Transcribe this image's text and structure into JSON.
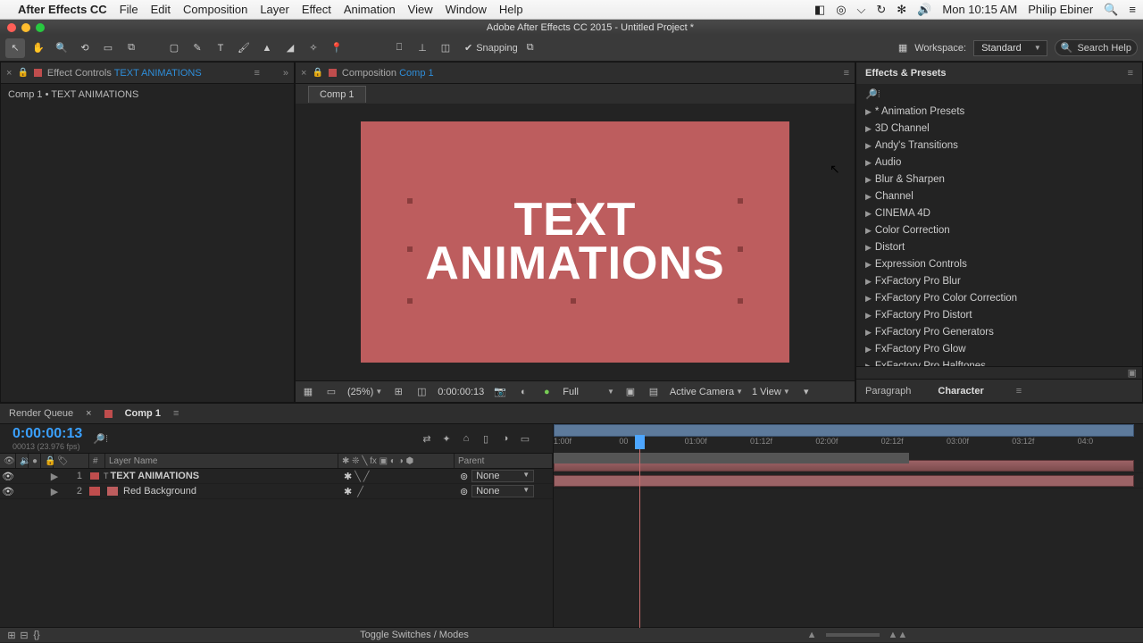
{
  "menubar": {
    "app": "After Effects CC",
    "items": [
      "File",
      "Edit",
      "Composition",
      "Layer",
      "Effect",
      "Animation",
      "View",
      "Window",
      "Help"
    ],
    "clock": "Mon 10:15 AM",
    "user": "Philip Ebiner"
  },
  "window_title": "Adobe After Effects CC 2015 - Untitled Project *",
  "toolbar": {
    "snapping": "Snapping",
    "workspace_label": "Workspace:",
    "workspace": "Standard",
    "search_placeholder": "Search Help"
  },
  "effect_controls": {
    "title": "Effect Controls",
    "layer": "TEXT ANIMATIONS",
    "breadcrumb": "Comp 1 • TEXT ANIMATIONS"
  },
  "composition": {
    "panel": "Composition",
    "name": "Comp 1",
    "tab": "Comp 1",
    "text_line1": "TEXT",
    "text_line2": "ANIMATIONS"
  },
  "viewer_footer": {
    "zoom": "(25%)",
    "timecode": "0:00:00:13",
    "resolution": "Full",
    "camera": "Active Camera",
    "views": "1 View"
  },
  "effects_presets": {
    "title": "Effects & Presets",
    "items": [
      "* Animation Presets",
      "3D Channel",
      "Andy's Transitions",
      "Audio",
      "Blur & Sharpen",
      "Channel",
      "CINEMA 4D",
      "Color Correction",
      "Distort",
      "Expression Controls",
      "FxFactory Pro Blur",
      "FxFactory Pro Color Correction",
      "FxFactory Pro Distort",
      "FxFactory Pro Generators",
      "FxFactory Pro Glow",
      "FxFactory Pro Halftones"
    ]
  },
  "para_char": {
    "paragraph": "Paragraph",
    "character": "Character"
  },
  "timeline": {
    "render_queue": "Render Queue",
    "tab": "Comp 1",
    "timecode": "0:00:00:13",
    "frames": "00013 (23.976 fps)",
    "header_num": "#",
    "header_layer": "Layer Name",
    "header_parent": "Parent",
    "layers": [
      {
        "num": "1",
        "name": "TEXT ANIMATIONS",
        "parent": "None",
        "color": "#bf4d4d",
        "type": "text"
      },
      {
        "num": "2",
        "name": "Red Background",
        "parent": "None",
        "color": "#bf4d4d",
        "type": "solid"
      }
    ],
    "ruler": [
      "1:00f",
      "00",
      "01:00f",
      "01:12f",
      "02:00f",
      "02:12f",
      "03:00f",
      "03:12f",
      "04:0"
    ],
    "toggle": "Toggle Switches / Modes"
  }
}
